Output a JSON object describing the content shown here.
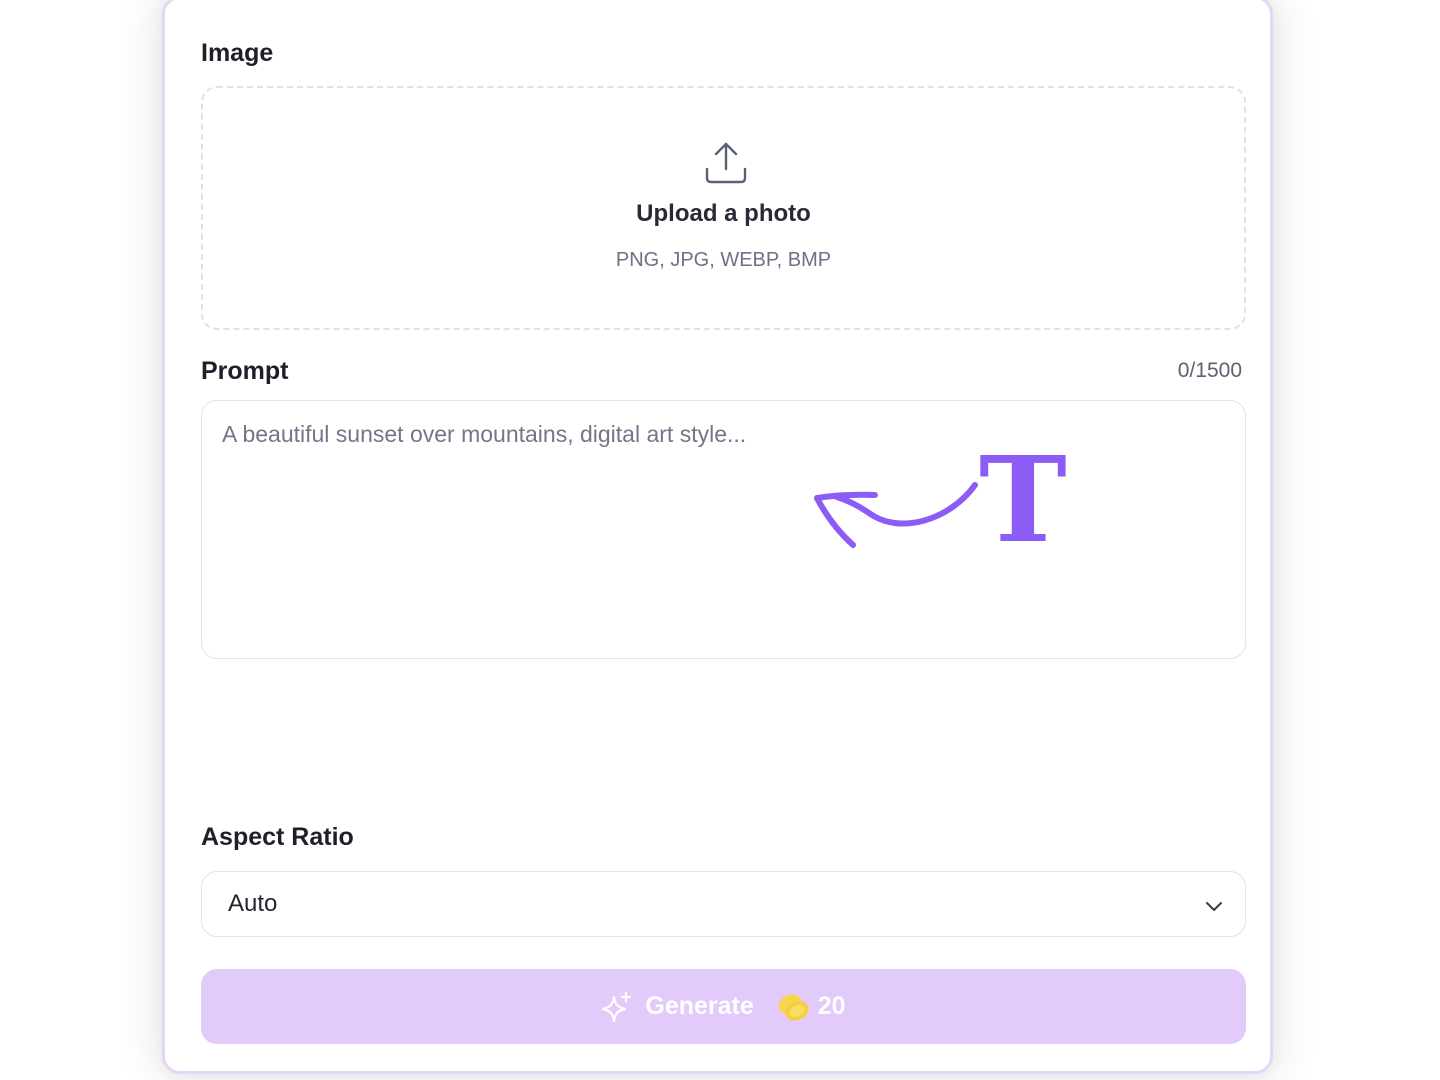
{
  "image_section": {
    "label": "Image",
    "upload": {
      "title": "Upload a photo",
      "formats": "PNG, JPG, WEBP, BMP",
      "icon": "upload-icon"
    }
  },
  "prompt_section": {
    "label": "Prompt",
    "counter": "0/1500",
    "value": "",
    "placeholder": "A beautiful sunset over mountains, digital art style...",
    "hint_icon": "text-hint-arrow-icon"
  },
  "aspect_ratio_section": {
    "label": "Aspect Ratio",
    "selected": "Auto",
    "icon": "chevron-down-icon"
  },
  "generate_button": {
    "label": "Generate",
    "cost": "20",
    "icons": [
      "sparkle-icon",
      "coins-icon"
    ]
  },
  "colors": {
    "accent": "#8b5cf6",
    "button_bg": "#e2cbfb",
    "card_border": "#e5d5f7",
    "coin": "#f7d44c"
  }
}
